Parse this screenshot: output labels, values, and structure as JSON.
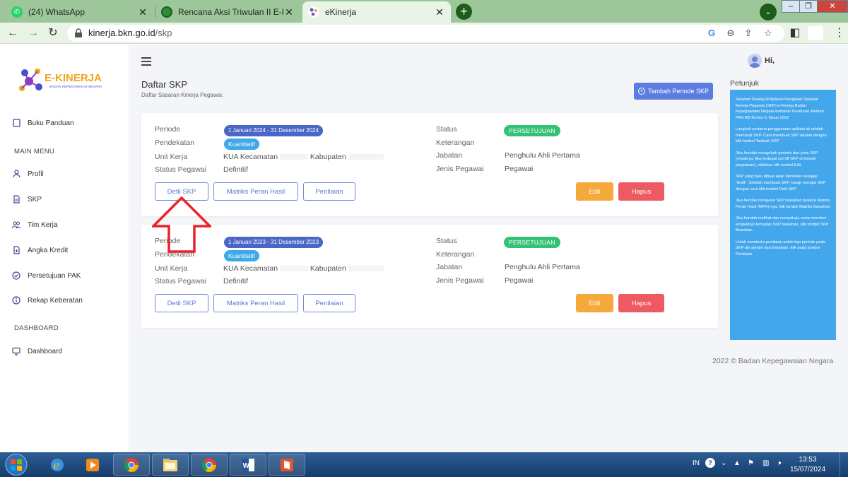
{
  "browser": {
    "tabs": [
      {
        "title": "(24) WhatsApp",
        "active": false
      },
      {
        "title": "Rencana Aksi Triwulan II E-Kinerja",
        "active": false
      },
      {
        "title": "eKinerja",
        "active": true
      }
    ],
    "url_host": "kinerja.bkn.go.id",
    "url_path": "/skp"
  },
  "app": {
    "logo_text": "E-KINERJA",
    "logo_subtext": "BADAN KEPEGAWAIAN NEGARA",
    "user_greeting": "Hi,"
  },
  "sidebar": {
    "top_item": "Buku Panduan",
    "main_menu_heading": "MAIN MENU",
    "main_items": [
      "Profil",
      "SKP",
      "Tim Kerja",
      "Angka Kredit",
      "Persetujuan PAK",
      "Rekap Keberatan"
    ],
    "dashboard_heading": "DASHBOARD",
    "dashboard_items": [
      "Dashboard"
    ]
  },
  "page": {
    "title": "Daftar SKP",
    "subtitle": "Daftar Sasaran Kinerja Pegawai.",
    "add_button": "Tambah Periode SKP"
  },
  "labels": {
    "periode": "Periode",
    "pendekatan": "Pendekatan",
    "unit_kerja": "Unit Kerja",
    "status_pegawai": "Status Pegawai",
    "status": "Status",
    "keterangan": "Keterangan",
    "jabatan": "Jabatan",
    "jenis_pegawai": "Jenis Pegawai"
  },
  "buttons": {
    "detil": "Detil SKP",
    "matriks": "Matriks Peran Hasil",
    "penilaian": "Penilaian",
    "edit": "Edit",
    "hapus": "Hapus"
  },
  "skp_list": [
    {
      "periode": "1 Januari 2024 - 31 Desember 2024",
      "pendekatan": "Kuantitatif",
      "unit_kerja_a": "KUA Kecamatan",
      "unit_kerja_b": "Kabupaten",
      "status_pegawai": "Definitif",
      "status": "PERSETUJUAN",
      "keterangan": "",
      "jabatan": "Penghulu Ahli Pertama",
      "jenis_pegawai": "Pegawai"
    },
    {
      "periode": "1 Januari 2023 - 31 Desember 2023",
      "pendekatan": "Kuantitatif",
      "unit_kerja_a": "KUA Kecamatan",
      "unit_kerja_b": "Kabupaten",
      "status_pegawai": "Definitif",
      "status": "PERSETUJUAN",
      "keterangan": "",
      "jabatan": "Penghulu Ahli Pertama",
      "jenis_pegawai": "Pegawai"
    }
  ],
  "petunjuk": {
    "title": "Petunjuk",
    "paragraphs": [
      "Selamat Datang di Aplikasi Pengisian Sasaran Kinerja Pegawai (SKP) e-Kinerja Badan Kepegawaian Negara berbasis Peraturan Menteri PAN RB Nomor 6 Tahun 2022",
      "Langkah pertama penggunaan aplikasi ini adalah membuat SKP. Cara membuat SKP adalah dengan klik tombol Tambah SKP",
      "Jika hendak mengubah periode dan jenis SKP (misalnya, jika terdapat cut-off SKP di tengah perjalanan), silahkan klik tombol Edit",
      "SKP yang baru dibuat akan berstatus sebagai \"draft\". Setelah membuat SKP, harap mengisi SKP dengan cara klik tombol Detil SKP",
      "Jika hendak mengatur SKP bawahan beserta Matriks Peran Hasil (MPH)-nya, klik tombol Matriks Bawahan",
      "Jika hendak melihat dan menyetujui serta memberi ekspektasi terhadap SKP bawahan, klik tombol SKP Bawahan",
      "Untuk membuka penilaian untuk tiap periode pada SKP diri sendiri dan bawahan, klik pada tombol Penilaian"
    ]
  },
  "footer": "2022 © Badan Kepegawaian Negara",
  "taskbar": {
    "lang": "IN",
    "time": "13:53",
    "date": "15/07/2024"
  },
  "colors": {
    "primary": "#5b7de0",
    "guide_bg": "#44a7ec",
    "status_green": "#33c274",
    "edit_orange": "#f6a93b",
    "delete_red": "#ee5a61"
  }
}
